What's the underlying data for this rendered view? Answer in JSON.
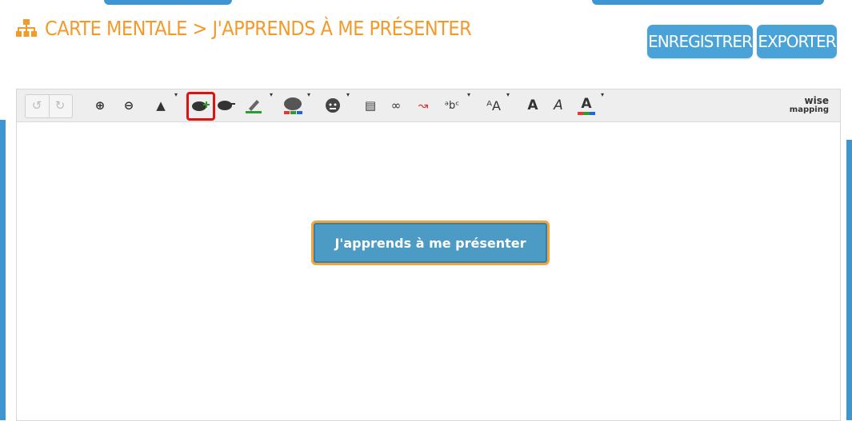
{
  "header": {
    "title": "CARTE MENTALE > J'APPRENDS À ME PRÉSENTER",
    "title_icon": "sitemap-icon",
    "title_color": "#f39a2c"
  },
  "actions": {
    "save_label": "ENREGISTRER",
    "export_label": "EXPORTER",
    "button_color": "#4aa3d8"
  },
  "toolbar": {
    "items": [
      "undo-icon",
      "redo-icon",
      "zoom-in-icon",
      "zoom-out-icon",
      "shape-icon",
      "add-topic-icon",
      "delete-topic-icon",
      "border-color-icon",
      "background-color-icon",
      "icon-picker-icon",
      "note-icon",
      "link-icon",
      "relationship-icon",
      "font-family-icon",
      "font-size-icon",
      "font-bold-icon",
      "font-italic-icon",
      "font-color-icon"
    ],
    "selected": "add-topic-icon",
    "logo_line1": "wise",
    "logo_line2": "mapping",
    "glyphs": {
      "undo": "↺",
      "redo": "↻",
      "zoom_in": "⊕",
      "zoom_out": "⊖",
      "shape": "▲",
      "add_topic": "☁",
      "delete_topic": "☁",
      "border": "✎",
      "bg": "◉",
      "icon": "☺",
      "note": "▤",
      "link": "∞",
      "relation": "↝",
      "font_family": "ᵃbᶜ",
      "font_size": "ᴬA",
      "bold": "A",
      "italic": "A",
      "color": "A"
    }
  },
  "mindmap": {
    "central_topic": "J'apprends à me présenter",
    "node_color": "#4b9bc5",
    "node_border": "#f0a640"
  }
}
